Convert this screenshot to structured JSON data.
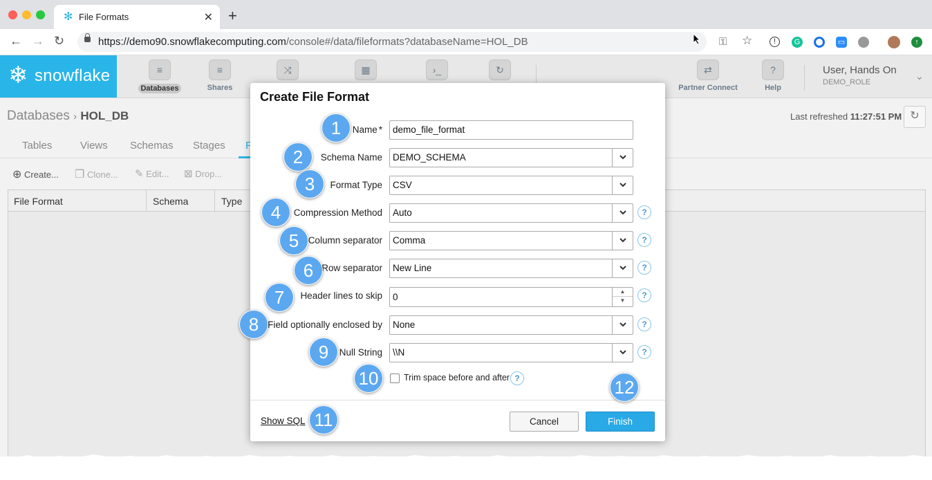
{
  "browser": {
    "tab_title": "File Formats",
    "url_host": "https://demo90.snowflakecomputing.com",
    "url_path": "/console#/data/fileformats?databaseName=HOL_DB"
  },
  "header": {
    "logo_text": "snowflake",
    "nav": [
      {
        "label": "Databases",
        "icon": "database-icon"
      },
      {
        "label": "Shares",
        "icon": "share-icon"
      },
      {
        "label": "",
        "icon": "shuffle-icon"
      },
      {
        "label": "",
        "icon": "grid-icon"
      },
      {
        "label": "",
        "icon": "terminal-icon"
      },
      {
        "label": "",
        "icon": "history-icon"
      }
    ],
    "partner_connect": "Partner Connect",
    "help": "Help",
    "user_name": "User, Hands On",
    "user_role": "DEMO_ROLE"
  },
  "page": {
    "breadcrumb_root": "Databases",
    "breadcrumb_sep": "›",
    "breadcrumb_current": "HOL_DB",
    "last_refreshed_label": "Last refreshed",
    "last_refreshed_time": "11:27:51 PM",
    "tabs": [
      "Tables",
      "Views",
      "Schemas",
      "Stages",
      "F"
    ],
    "toolbar": {
      "create": "Create...",
      "clone": "Clone...",
      "edit": "Edit...",
      "drop": "Drop..."
    },
    "columns": [
      "File Format",
      "Schema",
      "Type"
    ]
  },
  "dialog": {
    "title": "Create File Format",
    "fields": {
      "name": {
        "label": "Name",
        "required_mark": "*",
        "value": "demo_file_format"
      },
      "schema": {
        "label": "Schema Name",
        "value": "DEMO_SCHEMA"
      },
      "format_type": {
        "label": "Format Type",
        "value": "CSV"
      },
      "compression": {
        "label": "Compression Method",
        "value": "Auto"
      },
      "column_sep": {
        "label": "Column separator",
        "value": "Comma"
      },
      "row_sep": {
        "label": "Row separator",
        "value": "New Line"
      },
      "header_skip": {
        "label": "Header lines to skip",
        "value": "0"
      },
      "enclosed_by": {
        "label": "Field optionally enclosed by",
        "value": "None"
      },
      "null_string": {
        "label": "Null String",
        "value": "\\\\N"
      }
    },
    "trim_label": "Trim space before and after",
    "trim_checked": false,
    "show_sql": "Show SQL",
    "cancel": "Cancel",
    "finish": "Finish"
  },
  "steps": [
    "1",
    "2",
    "3",
    "4",
    "5",
    "6",
    "7",
    "8",
    "9",
    "10",
    "11",
    "12"
  ],
  "colors": {
    "brand": "#29b5e8",
    "step": "#5ca8f0",
    "finish": "#29a9e6"
  }
}
